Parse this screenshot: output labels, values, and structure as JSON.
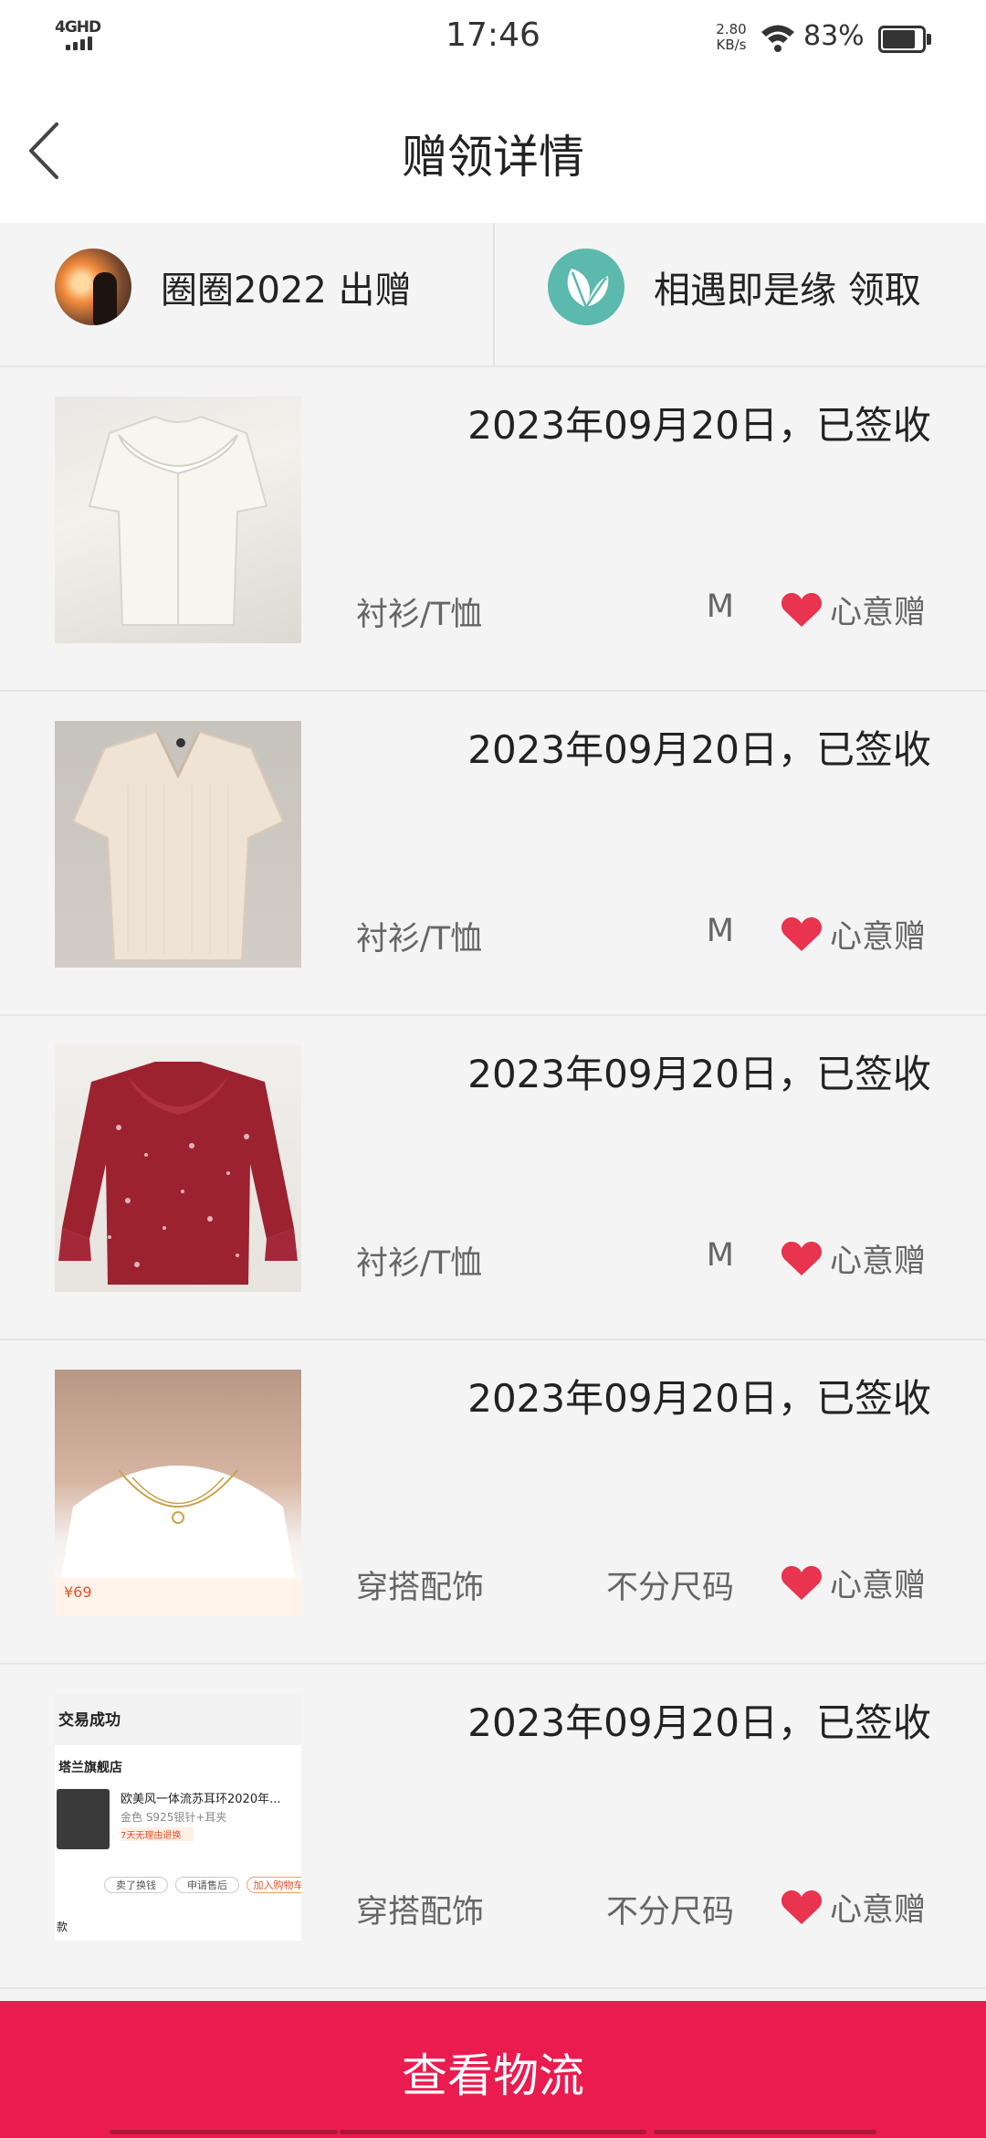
{
  "status_bar": {
    "network": "4GHD",
    "time": "17:46",
    "speed_value": "2.80",
    "speed_unit": "KB/s",
    "battery_percent": "83%",
    "battery_level": 0.83
  },
  "header": {
    "title": "赠领详情"
  },
  "users": {
    "giver_label": "圈圈2022 出赠",
    "receiver_label": "相遇即是缘 领取"
  },
  "items": [
    {
      "date_status": "2023年09月20日，已签收",
      "category": "衬衫/T恤",
      "size": "M",
      "gift_type": "心意赠"
    },
    {
      "date_status": "2023年09月20日，已签收",
      "category": "衬衫/T恤",
      "size": "M",
      "gift_type": "心意赠"
    },
    {
      "date_status": "2023年09月20日，已签收",
      "category": "衬衫/T恤",
      "size": "M",
      "gift_type": "心意赠"
    },
    {
      "date_status": "2023年09月20日，已签收",
      "category": "穿搭配饰",
      "size": "不分尺码",
      "gift_type": "心意赠"
    },
    {
      "date_status": "2023年09月20日，已签收",
      "category": "穿搭配饰",
      "size": "不分尺码",
      "gift_type": "心意赠"
    }
  ],
  "thumbnail_texts": {
    "item4_price": "¥69",
    "item5_header": "交易成功",
    "item5_store": "塔兰旗舰店",
    "item5_product": "欧美风一体流苏耳环2020年...",
    "item5_spec": "金色 S925银针+耳夹",
    "item5_badge": "7天无理由退换",
    "item5_btn1": "卖了换钱",
    "item5_btn2": "申请售后",
    "item5_btn3": "加入购物车",
    "item5_footer": "款"
  },
  "bottom": {
    "button_label": "查看物流"
  },
  "colors": {
    "accent": "#ea1c4f",
    "heart": "#e8344e",
    "page_bg": "#f4f4f4",
    "avatar_receiver": "#5bb9ad"
  },
  "icons": {
    "back": "chevron-left-icon",
    "heart": "heart-icon",
    "leaf": "leaf-icon"
  }
}
